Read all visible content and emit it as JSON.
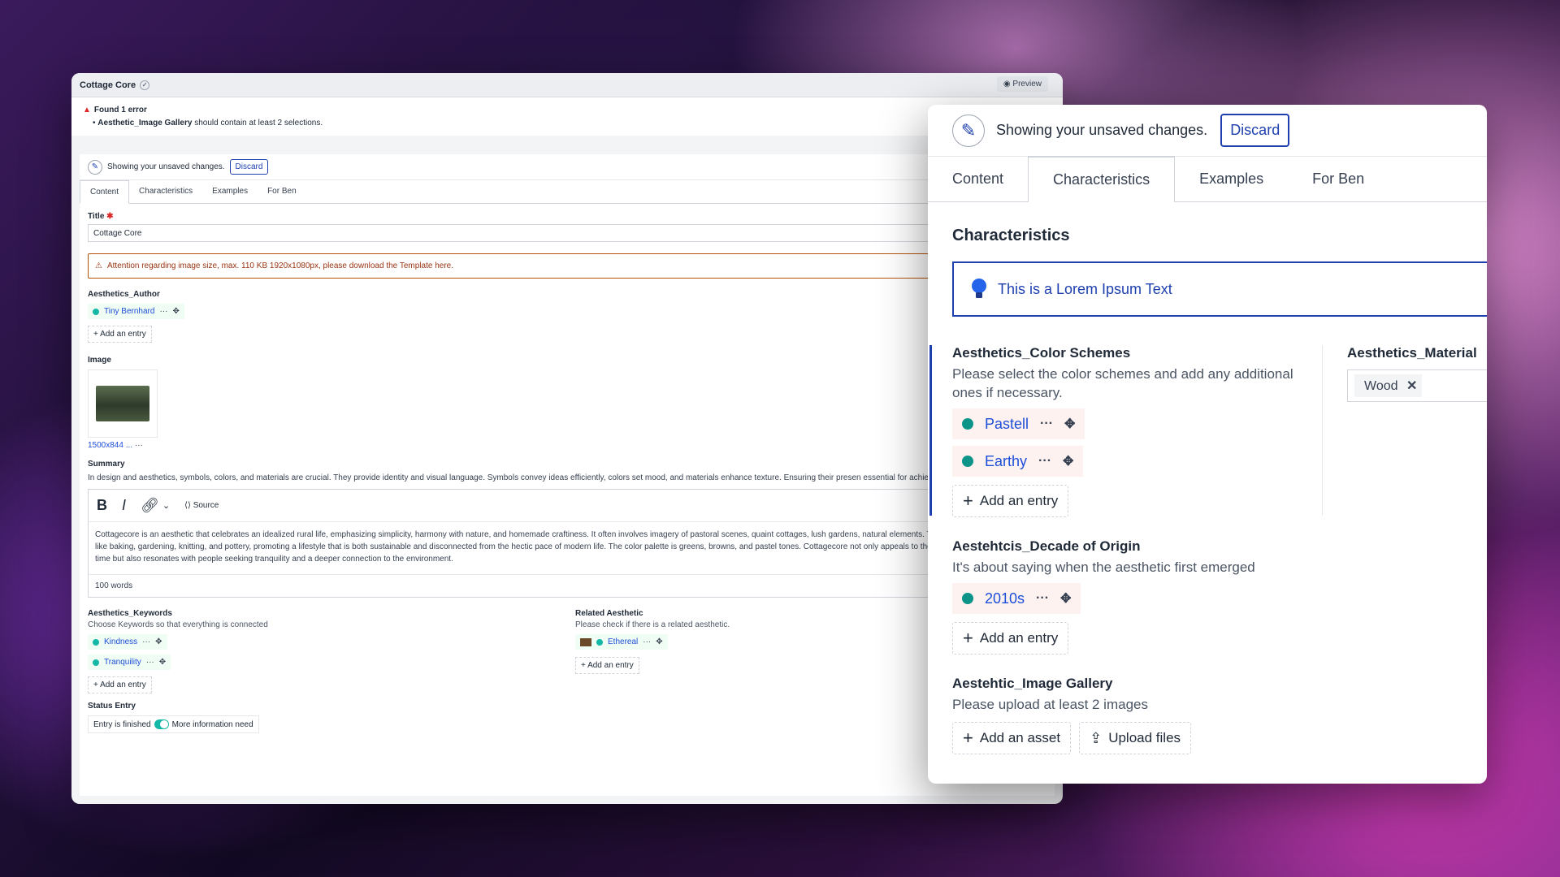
{
  "main": {
    "title": "Cottage Core",
    "preview_label": "Preview",
    "error": {
      "heading": "Found 1 error",
      "field": "Aesthetic_Image Gallery",
      "message": "should contain at least 2 selections."
    },
    "unsaved_text": "Showing your unsaved changes.",
    "discard_label": "Discard",
    "tabs": [
      "Content",
      "Characteristics",
      "Examples",
      "For Ben"
    ],
    "title_label": "Title",
    "title_value": "Cottage Core",
    "warning": "Attention regarding image size, max. 110 KB 1920x1080px, please download the Template here.",
    "author": {
      "label": "Aesthetics_Author",
      "entry": "Tiny Bernhard",
      "add": "Add an entry"
    },
    "image": {
      "label": "Image",
      "meta": "1500x844 ..."
    },
    "summary": {
      "label": "Summary",
      "description": "In design and aesthetics, symbols, colors, and materials are crucial. They provide identity and visual language. Symbols convey ideas efficiently, colors set mood, and materials enhance texture. Ensuring their presen essential for achieving the desired aesthetic.",
      "source_label": "Source",
      "text": "Cottagecore is an aesthetic that celebrates an idealized rural life, emphasizing simplicity, harmony with nature, and homemade craftiness. It often involves imagery of pastoral scenes, quaint cottages, lush gardens, natural elements. This aesthetic values activities like baking, gardening, knitting, and pottery, promoting a lifestyle that is both sustainable and disconnected from the hectic pace of modern life. The color palette is greens, browns, and pastel tones. Cottagecore not only appeals to those who yearn for a simpler time but also resonates with people seeking tranquility and a deeper connection to the environment.",
      "word_count": "100 words"
    },
    "keywords": {
      "label": "Aesthetics_Keywords",
      "description": "Choose Keywords so that everything is connected",
      "entries": [
        "Kindness",
        "Tranquility"
      ],
      "add": "Add an entry"
    },
    "related": {
      "label": "Related Aesthetic",
      "description": "Please check if there is a related aesthetic.",
      "entry": "Ethereal",
      "add": "Add an entry"
    },
    "status": {
      "label": "Status Entry",
      "left": "Entry is finished",
      "right": "More information need"
    }
  },
  "panel": {
    "unsaved_text": "Showing your unsaved changes.",
    "discard_label": "Discard",
    "tabs": [
      "Content",
      "Characteristics",
      "Examples",
      "For Ben"
    ],
    "active_tab": "Characteristics",
    "heading": "Characteristics",
    "info_text": "This is a Lorem Ipsum Text",
    "color_schemes": {
      "label": "Aesthetics_Color Schemes",
      "description": "Please select the color schemes and add any additional ones if necessary.",
      "entries": [
        "Pastell",
        "Earthy"
      ],
      "add": "Add an entry"
    },
    "material": {
      "label": "Aesthetics_Material",
      "tag": "Wood"
    },
    "decade": {
      "label": "Aestehtcis_Decade of Origin",
      "description": "It's about saying when the aesthetic first emerged",
      "entry": "2010s",
      "add": "Add an entry"
    },
    "gallery": {
      "label": "Aestehtic_Image Gallery",
      "description": "Please upload at least 2 images",
      "add_asset": "Add an asset",
      "upload": "Upload files"
    }
  },
  "colors": {
    "accent": "#1e40af",
    "status_dot": "#14b8a6",
    "warning": "#b45309",
    "error": "#dc2626"
  }
}
